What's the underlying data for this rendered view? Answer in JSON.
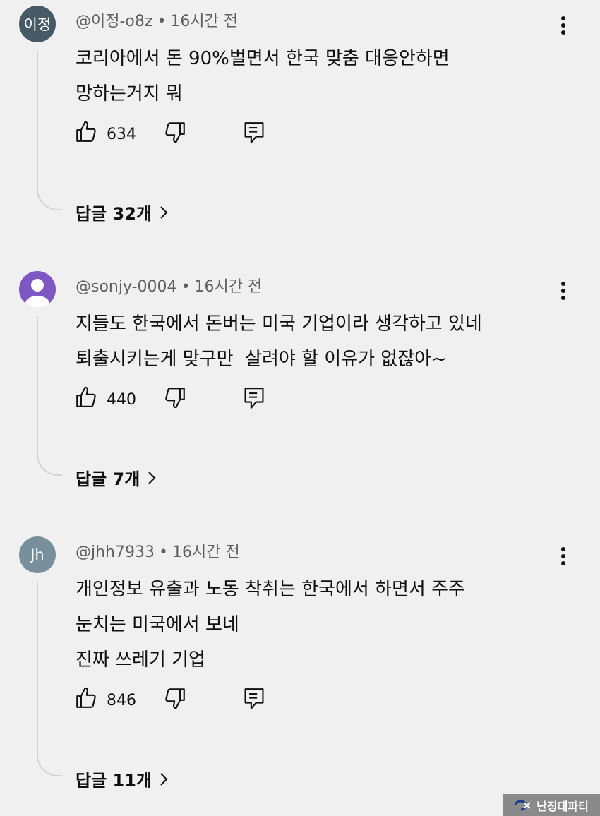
{
  "comments": [
    {
      "avatar": {
        "text": "이정",
        "color": "#455a64"
      },
      "handle": "@이정-o8z",
      "separator": "•",
      "time": "16시간 전",
      "lines": [
        "코리아에서 돈 90%벌면서 한국 맞춤 대응안하면",
        "망하는거지 뭐"
      ],
      "likes": "634",
      "replies_label": "답글 32개"
    },
    {
      "avatar": {
        "text": "",
        "icon": "default-person-avatar",
        "color": "#7e57c2"
      },
      "handle": "@sonjy-0004",
      "separator": "•",
      "time": "16시간 전",
      "lines": [
        "지들도 한국에서 돈버는 미국 기업이라 생각하고 있네",
        "퇴출시키는게 맞구만  살려야 할 이유가 없잖아~"
      ],
      "likes": "440",
      "replies_label": "답글 7개"
    },
    {
      "avatar": {
        "text": "Jh",
        "color": "#78909c"
      },
      "handle": "@jhh7933",
      "separator": "•",
      "time": "16시간 전",
      "lines": [
        "개인정보 유출과 노동 착취는 한국에서 하면서 주주",
        "눈치는 미국에서 보네",
        "진짜 쓰레기 기업"
      ],
      "likes": "846",
      "replies_label": "답글 11개"
    }
  ],
  "icons": {
    "more": "more-vertical-icon",
    "like": "thumb-up-icon",
    "dislike": "thumb-down-icon",
    "reply": "reply-comment-icon",
    "replies_arrow": "chevron-right-icon"
  },
  "watermark": {
    "text": "난징대파티"
  }
}
